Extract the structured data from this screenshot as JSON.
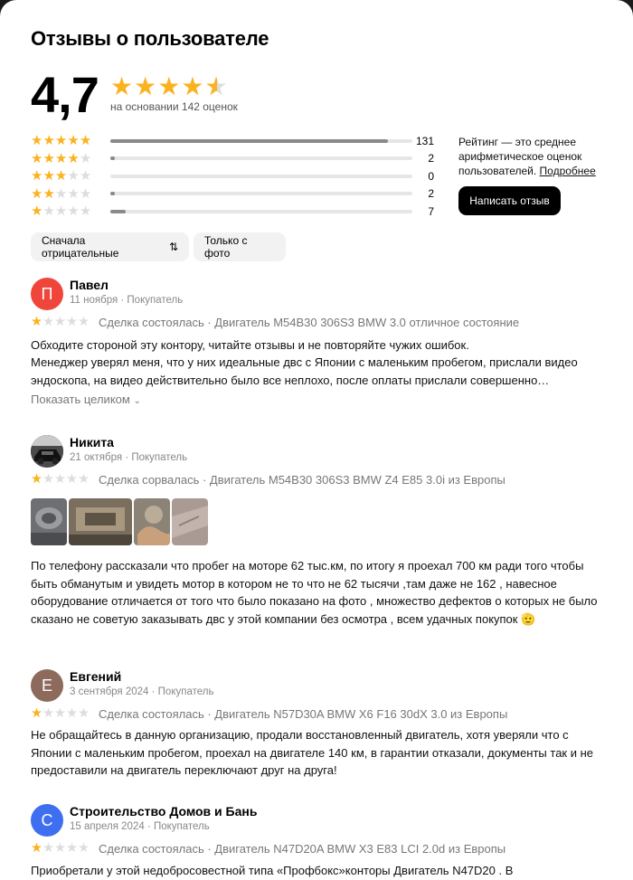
{
  "title": "Отзывы о пользователе",
  "rating": {
    "value": "4,7",
    "stars": 4.7,
    "based_on": "на основании 142 оценок",
    "distribution": [
      {
        "stars": 5,
        "count": "131",
        "fraction": 0.92
      },
      {
        "stars": 4,
        "count": "2",
        "fraction": 0.014
      },
      {
        "stars": 3,
        "count": "0",
        "fraction": 0
      },
      {
        "stars": 2,
        "count": "2",
        "fraction": 0.014
      },
      {
        "stars": 1,
        "count": "7",
        "fraction": 0.05
      }
    ]
  },
  "info": {
    "text": "Рейтинг — это среднее арифметическое оценок пользователей.",
    "link": "Подробнее"
  },
  "write_button": "Написать отзыв",
  "filters": {
    "sort": "Сначала отрицательные",
    "sort_icon": "sort-arrows-icon",
    "photo_only": "Только с фото"
  },
  "reviews": [
    {
      "initial": "П",
      "avatar_color": "#f0453a",
      "author": "Павел",
      "meta": "11 ноября · Покупатель",
      "stars": 1,
      "deal": "Сделка состоялась · Двигатель M54B30 306S3 BMW 3.0 отличное состояние",
      "text1": "Обходите стороной эту контору, читайте отзывы и не повторяйте чужих ошибок.",
      "text2": "Менеджер уверял меня, что у них идеальные двс с Японии с маленьким пробегом, прислали видео эндоскопа, на видео действительно было все неплохо, после оплаты прислали совершенно…",
      "more": "Показать целиком"
    },
    {
      "author": "Никита",
      "meta": "21 октября · Покупатель",
      "stars": 1,
      "deal": "Сделка сорвалась · Двигатель M54B30 306S3 BMW Z4 E85 3.0i из Европы",
      "text": "По телефону рассказали что пробег на моторе 62 тыс.км, по итогу я проехал 700 км ради того чтобы быть обманутым и увидеть мотор в котором не то что не 62 тысячи ,там даже не 162 , навесное оборудование отличается от того что было показано на фото , множество дефектов о которых не было сказано не советую заказывать двс у этой компании без осмотра , всем удачных покупок 🫡"
    },
    {
      "initial": "Е",
      "avatar_color": "#8d6a5c",
      "author": "Евгений",
      "meta": "3 сентября 2024 · Покупатель",
      "stars": 1,
      "deal": "Сделка состоялась · Двигатель N57D30A BMW X6 F16 30dX 3.0 из Европы",
      "text": "Не обращайтесь в данную организацию, продали восстановленный двигатель, хотя уверяли что с Японии с маленьким пробегом, проехал на двигателе 140 км, в гарантии отказали, документы так и не предоставили на двигатель переключают друг на друга!"
    },
    {
      "initial": "С",
      "avatar_color": "#3e6ff0",
      "author": "Строительство Домов и Бань",
      "meta": "15 апреля 2024 · Покупатель",
      "stars": 1,
      "deal": "Сделка состоялась · Двигатель N47D20A BMW X3 E83 LCI 2.0d из Европы",
      "text": "Приобретали у этой недобросовестной типа «Профбокс»конторы Двигатель N47D20 . В"
    }
  ]
}
